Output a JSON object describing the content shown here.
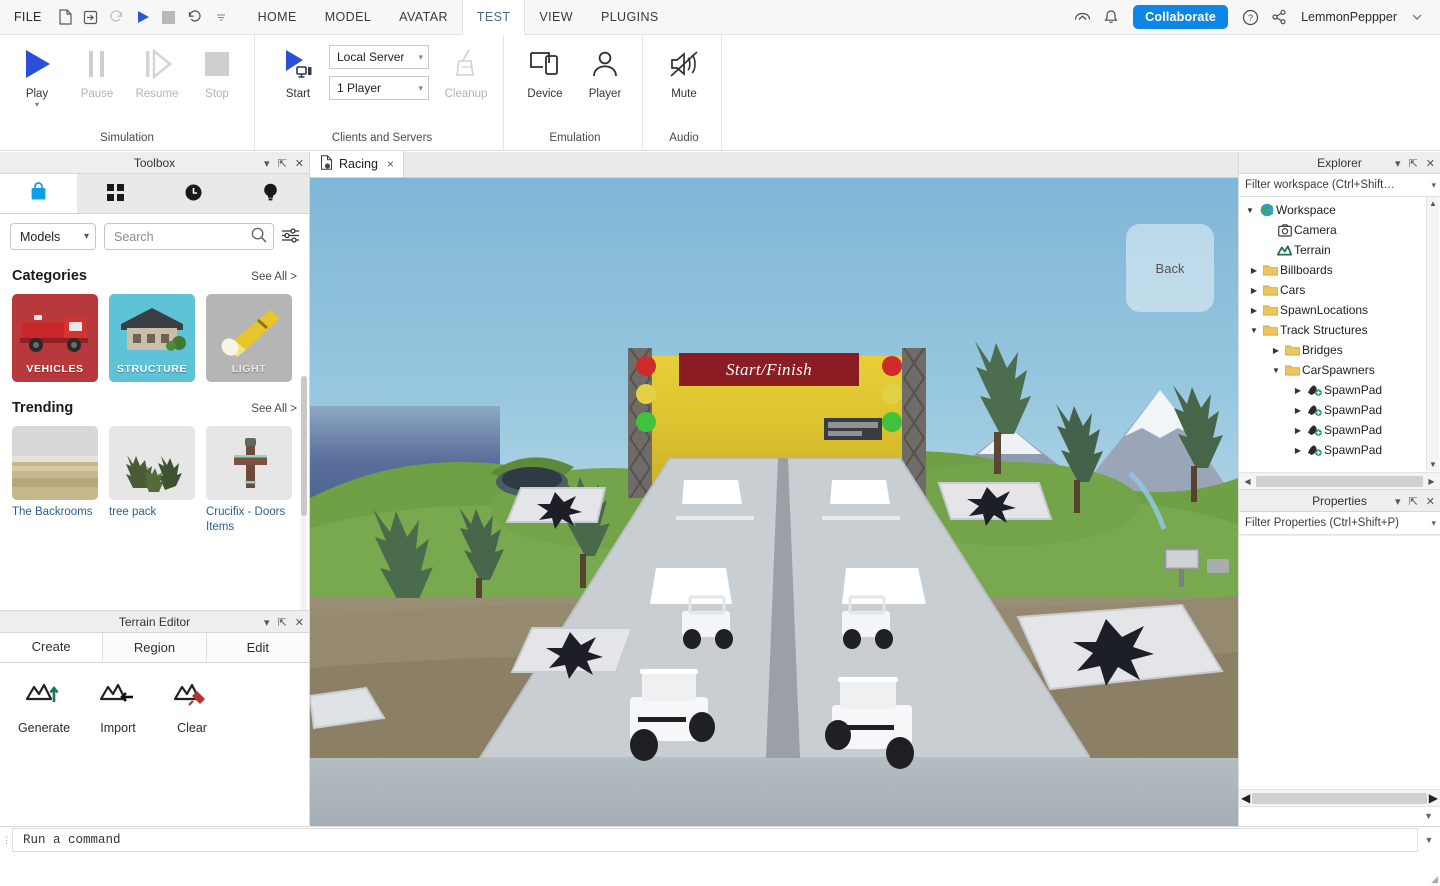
{
  "menubar": {
    "file_label": "FILE",
    "quick_actions": [
      {
        "name": "new-document-icon",
        "glyph": "doc"
      },
      {
        "name": "open-import-icon",
        "glyph": "import"
      },
      {
        "name": "redo-icon",
        "glyph": "redo",
        "disabled": true
      },
      {
        "name": "play-icon",
        "glyph": "play"
      },
      {
        "name": "stop-icon",
        "glyph": "stop"
      },
      {
        "name": "undo-icon",
        "glyph": "undo"
      },
      {
        "name": "customize-caret-icon",
        "glyph": "caret"
      }
    ],
    "tabs": [
      {
        "label": "HOME",
        "active": false
      },
      {
        "label": "MODEL",
        "active": false
      },
      {
        "label": "AVATAR",
        "active": false
      },
      {
        "label": "TEST",
        "active": true
      },
      {
        "label": "VIEW",
        "active": false
      },
      {
        "label": "PLUGINS",
        "active": false
      }
    ],
    "collaborate_label": "Collaborate",
    "username": "LemmonPeppper",
    "accent_blue": "#0e86e6",
    "active_tab_text": "#4a6a85"
  },
  "ribbon": {
    "groups": [
      {
        "label": "Simulation",
        "buttons": [
          {
            "label": "Play",
            "icon": "play-icon",
            "disabled": false,
            "has_caret": true
          },
          {
            "label": "Pause",
            "icon": "pause-icon",
            "disabled": true
          },
          {
            "label": "Resume",
            "icon": "resume-icon",
            "disabled": true
          },
          {
            "label": "Stop",
            "icon": "stop-icon",
            "disabled": true
          }
        ]
      },
      {
        "label": "Clients and Servers",
        "buttons": [
          {
            "label": "Start",
            "icon": "start-server-icon",
            "disabled": false
          },
          {
            "label": "Cleanup",
            "icon": "cleanup-broom-icon",
            "disabled": true
          }
        ],
        "combos": [
          {
            "name": "server-mode-select",
            "value": "Local Server"
          },
          {
            "name": "player-count-select",
            "value": "1 Player"
          }
        ]
      },
      {
        "label": "Emulation",
        "buttons": [
          {
            "label": "Device",
            "icon": "device-icon",
            "disabled": false
          },
          {
            "label": "Player",
            "icon": "player-icon",
            "disabled": false
          }
        ]
      },
      {
        "label": "Audio",
        "buttons": [
          {
            "label": "Mute",
            "icon": "mute-icon",
            "disabled": false
          }
        ]
      }
    ]
  },
  "toolbox": {
    "title": "Toolbox",
    "tabs": [
      {
        "name": "marketplace-bag-icon",
        "active": true
      },
      {
        "name": "inventory-grid-icon",
        "active": false
      },
      {
        "name": "recent-clock-icon",
        "active": false
      },
      {
        "name": "creations-bulb-icon",
        "active": false
      }
    ],
    "category_select": "Models",
    "search_placeholder": "Search",
    "categories_title": "Categories",
    "categories_see_all": "See All >",
    "categories": [
      {
        "label": "VEHICLES",
        "bg": "#b8393c"
      },
      {
        "label": "STRUCTURE",
        "bg": "#5ec3d6"
      },
      {
        "label": "LIGHT",
        "bg": "#b5b5b5"
      }
    ],
    "trending_title": "Trending",
    "trending_see_all": "See All >",
    "trending": [
      {
        "name": "The Backrooms"
      },
      {
        "name": "tree pack"
      },
      {
        "name": "Crucifix - Doors Items"
      }
    ]
  },
  "terrain_editor": {
    "title": "Terrain Editor",
    "tabs": [
      {
        "label": "Create",
        "active": true
      },
      {
        "label": "Region",
        "active": false
      },
      {
        "label": "Edit",
        "active": false
      }
    ],
    "buttons": [
      {
        "label": "Generate",
        "icon": "terrain-generate-icon"
      },
      {
        "label": "Import",
        "icon": "terrain-import-icon"
      },
      {
        "label": "Clear",
        "icon": "terrain-clear-icon"
      }
    ]
  },
  "editor": {
    "tab_label": "Racing",
    "tab_close": "×",
    "viewport": {
      "banner_text": "Start/Finish",
      "navcube_label": "Back",
      "banner_bg": "#8b1c22",
      "wall_color": "#ddc32e",
      "sky_color": "#7fb6d6"
    }
  },
  "explorer": {
    "title": "Explorer",
    "filter_placeholder": "Filter workspace (Ctrl+Shift…",
    "tree": [
      {
        "label": "Workspace",
        "depth": 0,
        "icon": "workspace-globe-icon",
        "twisty": "down"
      },
      {
        "label": "Camera",
        "depth": 1,
        "icon": "camera-icon",
        "twisty": ""
      },
      {
        "label": "Terrain",
        "depth": 1,
        "icon": "terrain-icon",
        "twisty": ""
      },
      {
        "label": "Billboards",
        "depth": 1,
        "icon": "folder-icon",
        "twisty": "right"
      },
      {
        "label": "Cars",
        "depth": 1,
        "icon": "folder-icon",
        "twisty": "right"
      },
      {
        "label": "SpawnLocations",
        "depth": 1,
        "icon": "folder-icon",
        "twisty": "right"
      },
      {
        "label": "Track Structures",
        "depth": 1,
        "icon": "folder-icon",
        "twisty": "down"
      },
      {
        "label": "Bridges",
        "depth": 2,
        "icon": "folder-icon",
        "twisty": "right"
      },
      {
        "label": "CarSpawners",
        "depth": 2,
        "icon": "folder-icon",
        "twisty": "down"
      },
      {
        "label": "SpawnPad",
        "depth": 3,
        "icon": "spawnpad-icon",
        "twisty": "right"
      },
      {
        "label": "SpawnPad",
        "depth": 3,
        "icon": "spawnpad-icon",
        "twisty": "right"
      },
      {
        "label": "SpawnPad",
        "depth": 3,
        "icon": "spawnpad-icon",
        "twisty": "right"
      },
      {
        "label": "SpawnPad",
        "depth": 3,
        "icon": "spawnpad-icon",
        "twisty": "right"
      }
    ]
  },
  "properties": {
    "title": "Properties",
    "filter_placeholder": "Filter Properties (Ctrl+Shift+P)"
  },
  "command_bar": {
    "placeholder": "Run a command"
  }
}
